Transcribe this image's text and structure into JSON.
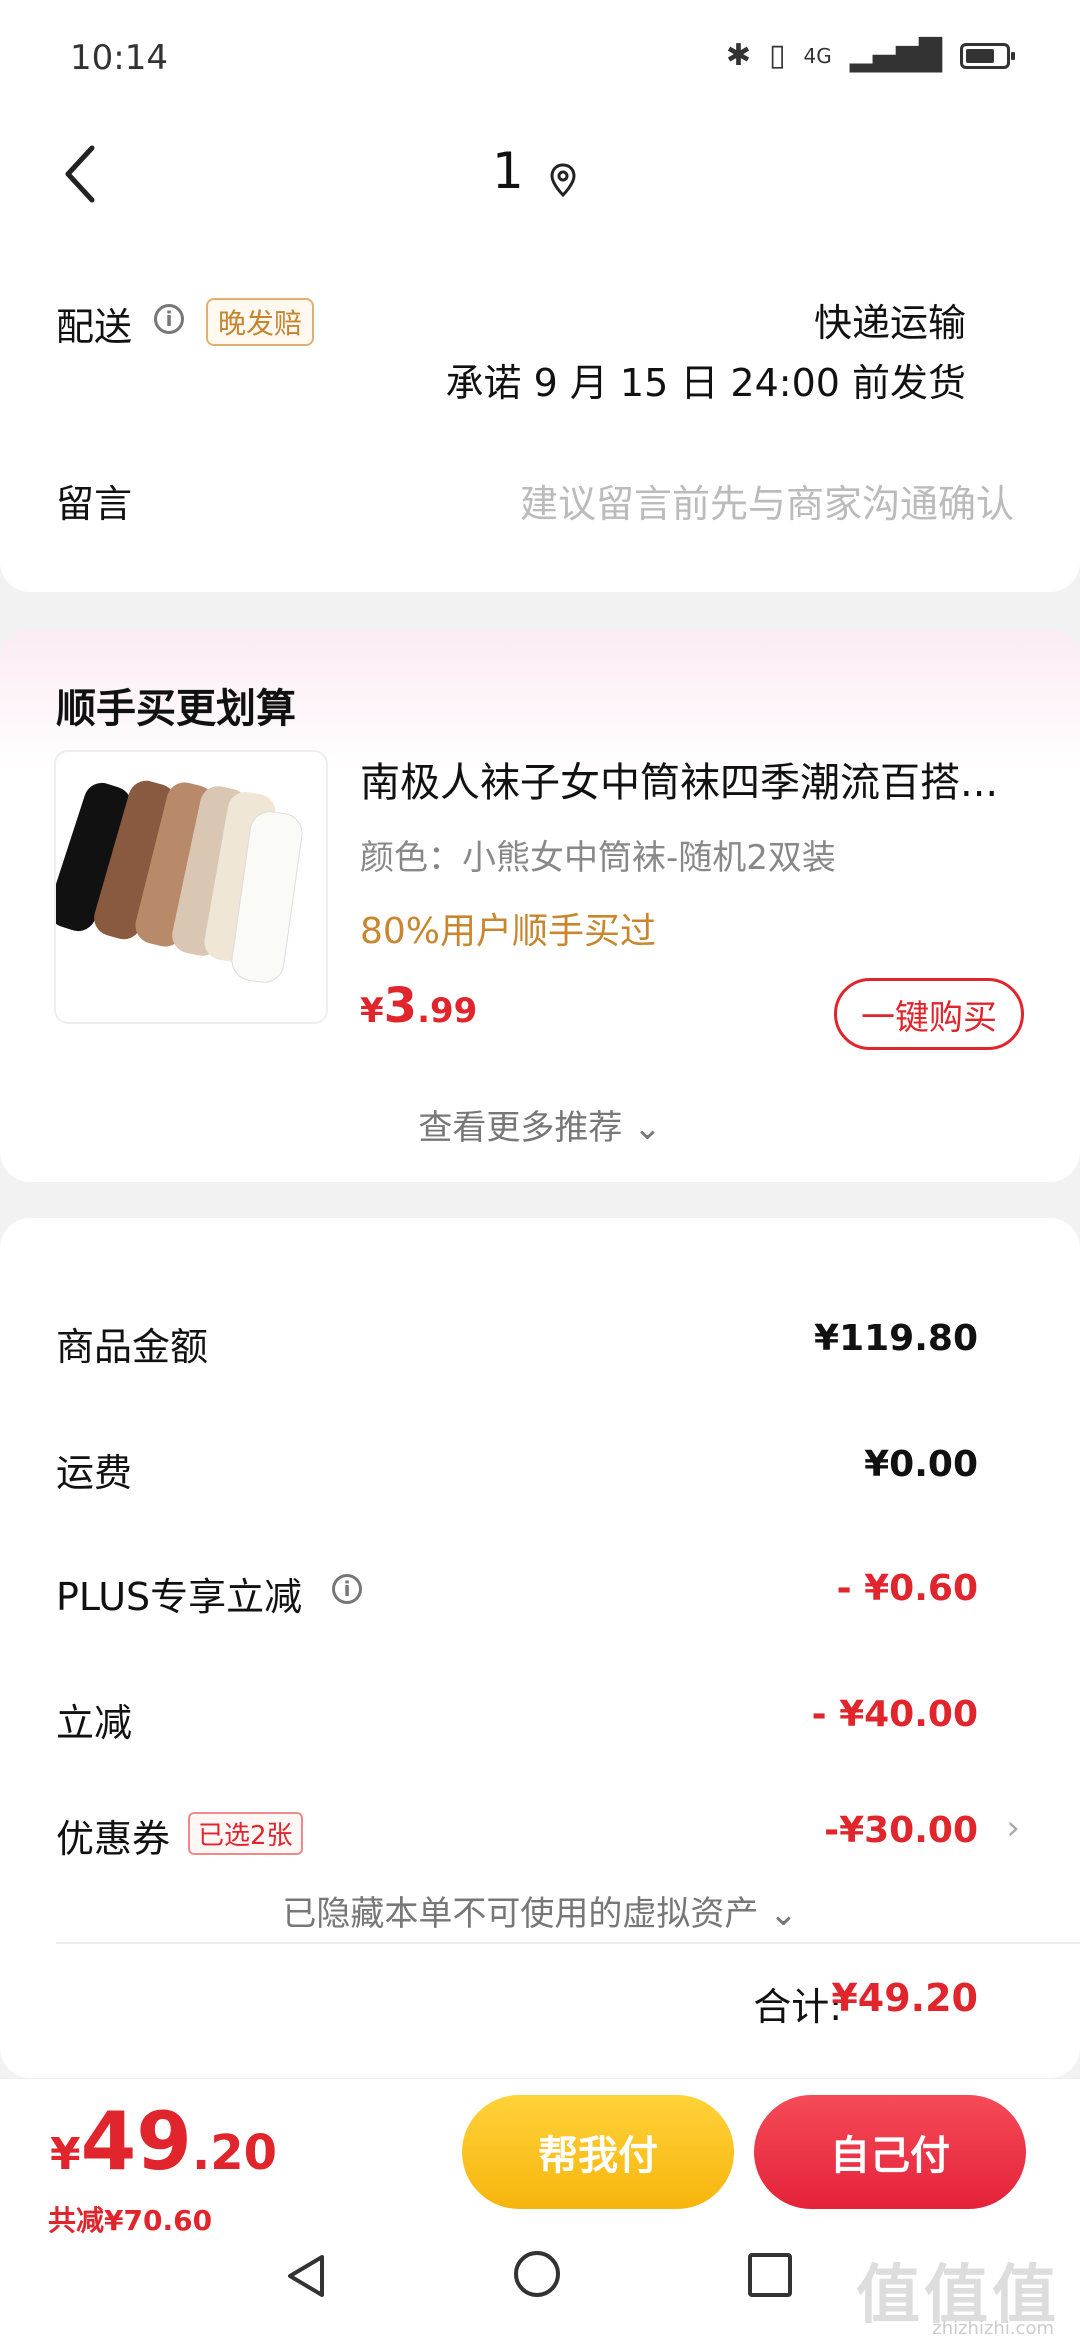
{
  "status_bar": {
    "time": "10:14",
    "network": "4G"
  },
  "header": {
    "title": "1"
  },
  "delivery": {
    "label": "配送",
    "badge": "晚发赔",
    "method": "快递运输",
    "promise": "承诺 9 月 15 日 24:00 前发货"
  },
  "note": {
    "label": "留言",
    "placeholder": "建议留言前先与商家沟通确认"
  },
  "addon": {
    "title": "顺手买更划算",
    "product": {
      "title": "南极人袜子女中筒袜四季潮流百搭...",
      "spec": "颜色：小熊女中筒袜-随机2双装",
      "buy_rate": "80%用户顺手买过",
      "price_yen": "¥",
      "price_int": "3",
      "price_dec": ".99",
      "buy_button": "一键购买"
    },
    "more": "查看更多推荐 ⌄"
  },
  "summary": {
    "rows": [
      {
        "label": "商品金额",
        "value": "¥119.80"
      },
      {
        "label": "运费",
        "value": "¥0.00"
      },
      {
        "label": "PLUS专享立减",
        "value": "- ¥0.60"
      },
      {
        "label": "立减",
        "value": "- ¥40.00"
      },
      {
        "label": "优惠券",
        "badge": "已选2张",
        "value": "-¥30.00"
      }
    ],
    "hidden_assets": "已隐藏本单不可使用的虚拟资产 ⌄",
    "total_label": "合计:",
    "total_value": "¥49.20"
  },
  "bottom": {
    "price_yen": "¥",
    "price_int": "49",
    "price_dec": ".20",
    "saved": "共减¥70.60",
    "help_pay": "帮我付",
    "self_pay": "自己付"
  },
  "watermark": {
    "main": "值值值",
    "sub": "zhizhizhi.com"
  },
  "colors": {
    "accent": "#e0252c",
    "gold": "#c8872e",
    "yellow_button": "#f7b50c"
  }
}
